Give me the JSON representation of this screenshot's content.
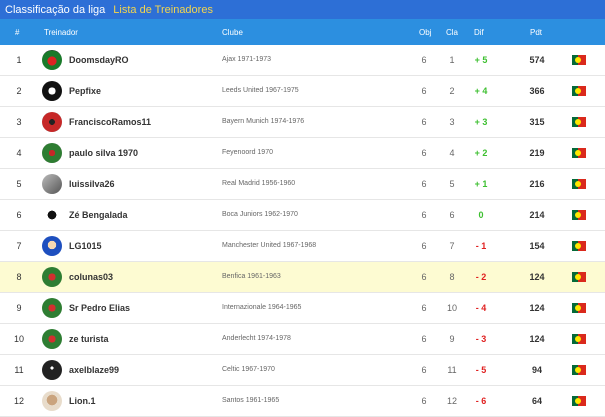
{
  "header": {
    "title": "Classificação da liga",
    "subtitle": "Lista de Treinadores"
  },
  "columns": {
    "num": "#",
    "coach": "Treinador",
    "club": "Clube",
    "obj": "Obj",
    "cla": "Cla",
    "dif": "Dif",
    "pts": "Pdt"
  },
  "colors": {
    "topbar": "#2d6fd6",
    "table_header": "#2c8fe0",
    "subtitle": "#f3d54e",
    "positive": "#3cbf2f",
    "negative": "#e02020",
    "highlight_row": "#fdfbd2"
  },
  "rows": [
    {
      "num": "1",
      "name": "DoomsdayRO",
      "club": "Ajax 1971-1973",
      "obj": "6",
      "cla": "1",
      "dif": "+ 5",
      "dif_sign": "pos",
      "pts": "574",
      "avatar": "avatar-green-red-badge",
      "highlight": false
    },
    {
      "num": "2",
      "name": "Pepfixe",
      "club": "Leeds United 1967-1975",
      "obj": "6",
      "cla": "2",
      "dif": "+ 4",
      "dif_sign": "pos",
      "pts": "366",
      "avatar": "avatar-black-white-crest",
      "highlight": false
    },
    {
      "num": "3",
      "name": "FranciscoRamos11",
      "club": "Bayern Munich 1974-1976",
      "obj": "6",
      "cla": "3",
      "dif": "+ 3",
      "dif_sign": "pos",
      "pts": "315",
      "avatar": "avatar-red-crest",
      "highlight": false
    },
    {
      "num": "4",
      "name": "paulo silva 1970",
      "club": "Feyenoord 1970",
      "obj": "6",
      "cla": "4",
      "dif": "+ 2",
      "dif_sign": "pos",
      "pts": "219",
      "avatar": "avatar-green-crest",
      "highlight": false
    },
    {
      "num": "5",
      "name": "luissilva26",
      "club": "Real Madrid 1956-1960",
      "obj": "6",
      "cla": "5",
      "dif": "+ 1",
      "dif_sign": "pos",
      "pts": "216",
      "avatar": "avatar-photo-gray",
      "highlight": false
    },
    {
      "num": "6",
      "name": "Zé Bengalada",
      "club": "Boca Juniors 1962-1970",
      "obj": "6",
      "cla": "6",
      "dif": "0",
      "dif_sign": "zero",
      "pts": "214",
      "avatar": "avatar-small-black",
      "highlight": false
    },
    {
      "num": "7",
      "name": "LG1015",
      "club": "Manchester United 1967-1968",
      "obj": "6",
      "cla": "7",
      "dif": "- 1",
      "dif_sign": "neg",
      "pts": "154",
      "avatar": "avatar-cartoon-blue",
      "highlight": false
    },
    {
      "num": "8",
      "name": "colunas03",
      "club": "Benfica 1961-1963",
      "obj": "6",
      "cla": "8",
      "dif": "- 2",
      "dif_sign": "neg",
      "pts": "124",
      "avatar": "avatar-green-red-crest",
      "highlight": true
    },
    {
      "num": "9",
      "name": "Sr Pedro Elias",
      "club": "Internazionale 1964-1965",
      "obj": "6",
      "cla": "10",
      "dif": "- 4",
      "dif_sign": "neg",
      "pts": "124",
      "avatar": "avatar-green-red-crest",
      "highlight": false
    },
    {
      "num": "10",
      "name": "ze turista",
      "club": "Anderlecht 1974-1978",
      "obj": "6",
      "cla": "9",
      "dif": "- 3",
      "dif_sign": "neg",
      "pts": "124",
      "avatar": "avatar-green-red-crest",
      "highlight": false
    },
    {
      "num": "11",
      "name": "axelblaze99",
      "club": "Celtic 1967-1970",
      "obj": "6",
      "cla": "11",
      "dif": "- 5",
      "dif_sign": "neg",
      "pts": "94",
      "avatar": "avatar-dark-character",
      "highlight": false
    },
    {
      "num": "12",
      "name": "Lion.1",
      "club": "Santos 1961-1965",
      "obj": "6",
      "cla": "12",
      "dif": "- 6",
      "dif_sign": "neg",
      "pts": "64",
      "avatar": "avatar-photo-beige",
      "highlight": false
    }
  ]
}
